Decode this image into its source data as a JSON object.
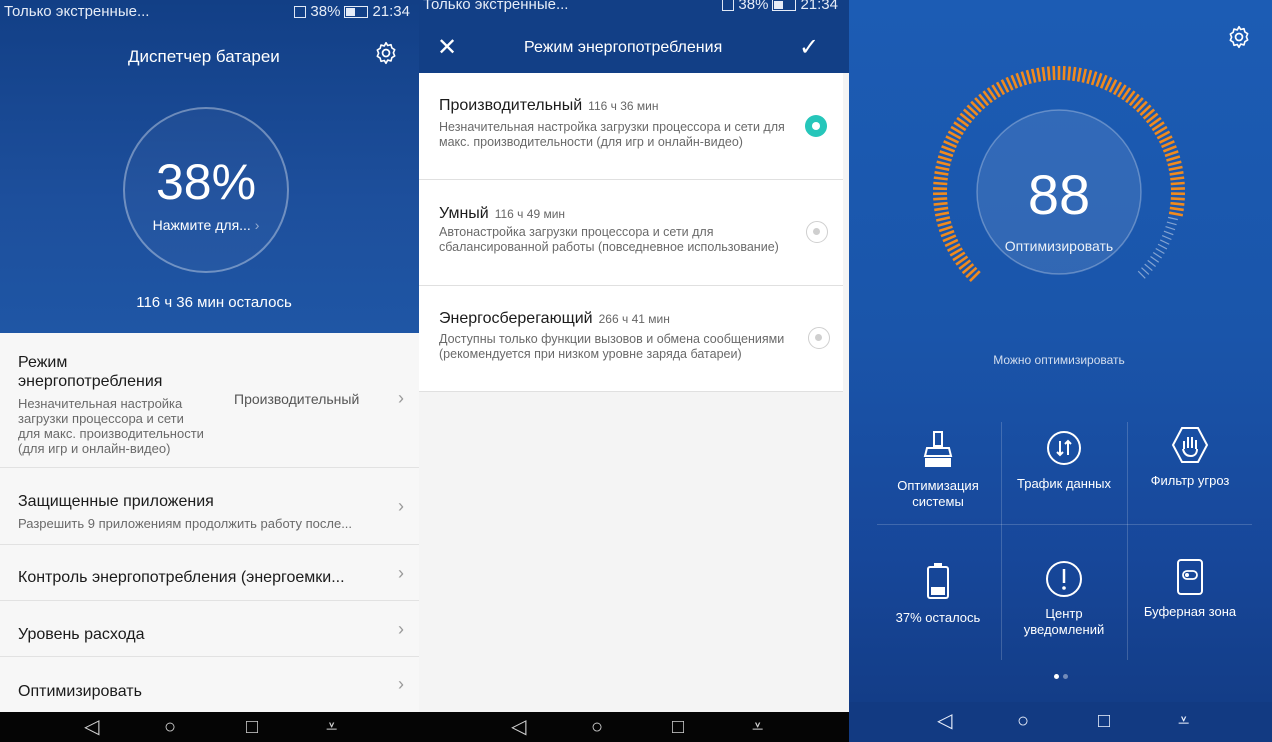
{
  "panel1": {
    "status": {
      "left": "Только экстренные...",
      "battery": "38%",
      "time": "21:34"
    },
    "title": "Диспетчер батареи",
    "percent": "38%",
    "tap_hint": "Нажмите для...",
    "time_left": "116 ч 36 мин осталось",
    "rows": [
      {
        "title": "Режим\nэнергопотребления",
        "desc": "Незначительная настройка\nзагрузки процессора и сети\nдля макс. производительности\n(для игр и онлайн-видео)",
        "value": "Производительный"
      },
      {
        "title": "Защищенные приложения",
        "desc": "Разрешить 9 приложениям продолжить работу после..."
      },
      {
        "title": "Контроль энергопотребления (энергоемки..."
      },
      {
        "title": "Уровень расхода"
      },
      {
        "title": "Оптимизировать"
      }
    ]
  },
  "panel2": {
    "status": {
      "left": "Только экстренные...",
      "battery": "38%",
      "time": "21:34"
    },
    "title": "Режим энергопотребления",
    "options": [
      {
        "name": "Производительный",
        "time": "116 ч 36 мин",
        "desc": "Незначительная настройка загрузки процессора и сети для макс. производительности (для игр и онлайн-видео)",
        "selected": true
      },
      {
        "name": "Умный",
        "time": "116 ч 49 мин",
        "desc": "Автонастройка загрузки процессора и сети для сбалансированной работы (повседневное использование)",
        "selected": false
      },
      {
        "name": "Энергосберегающий",
        "time": "266 ч 41 мин",
        "desc": "Доступны только функции вызовов и обмена сообщениями (рекомендуется при низком уровне заряда батареи)",
        "selected": false
      }
    ]
  },
  "panel3": {
    "score": "88",
    "score_label": "Оптимизировать",
    "score_fraction": 0.88,
    "hint": "Можно оптимизировать",
    "tiles": [
      {
        "label": "Оптимизация\nсистемы",
        "icon": "broom-icon"
      },
      {
        "label": "Трафик данных",
        "icon": "data-traffic-icon"
      },
      {
        "label": "Фильтр угроз",
        "icon": "hand-shield-icon"
      },
      {
        "label": "37% осталось",
        "icon": "battery-icon"
      },
      {
        "label": "Центр\nуведомлений",
        "icon": "alert-icon"
      },
      {
        "label": "Буферная зона",
        "icon": "buffer-zone-icon"
      }
    ]
  },
  "colors": {
    "header_blue": "#123f86",
    "accent_teal": "#26c6ba",
    "gauge_orange": "#f08a1e"
  }
}
